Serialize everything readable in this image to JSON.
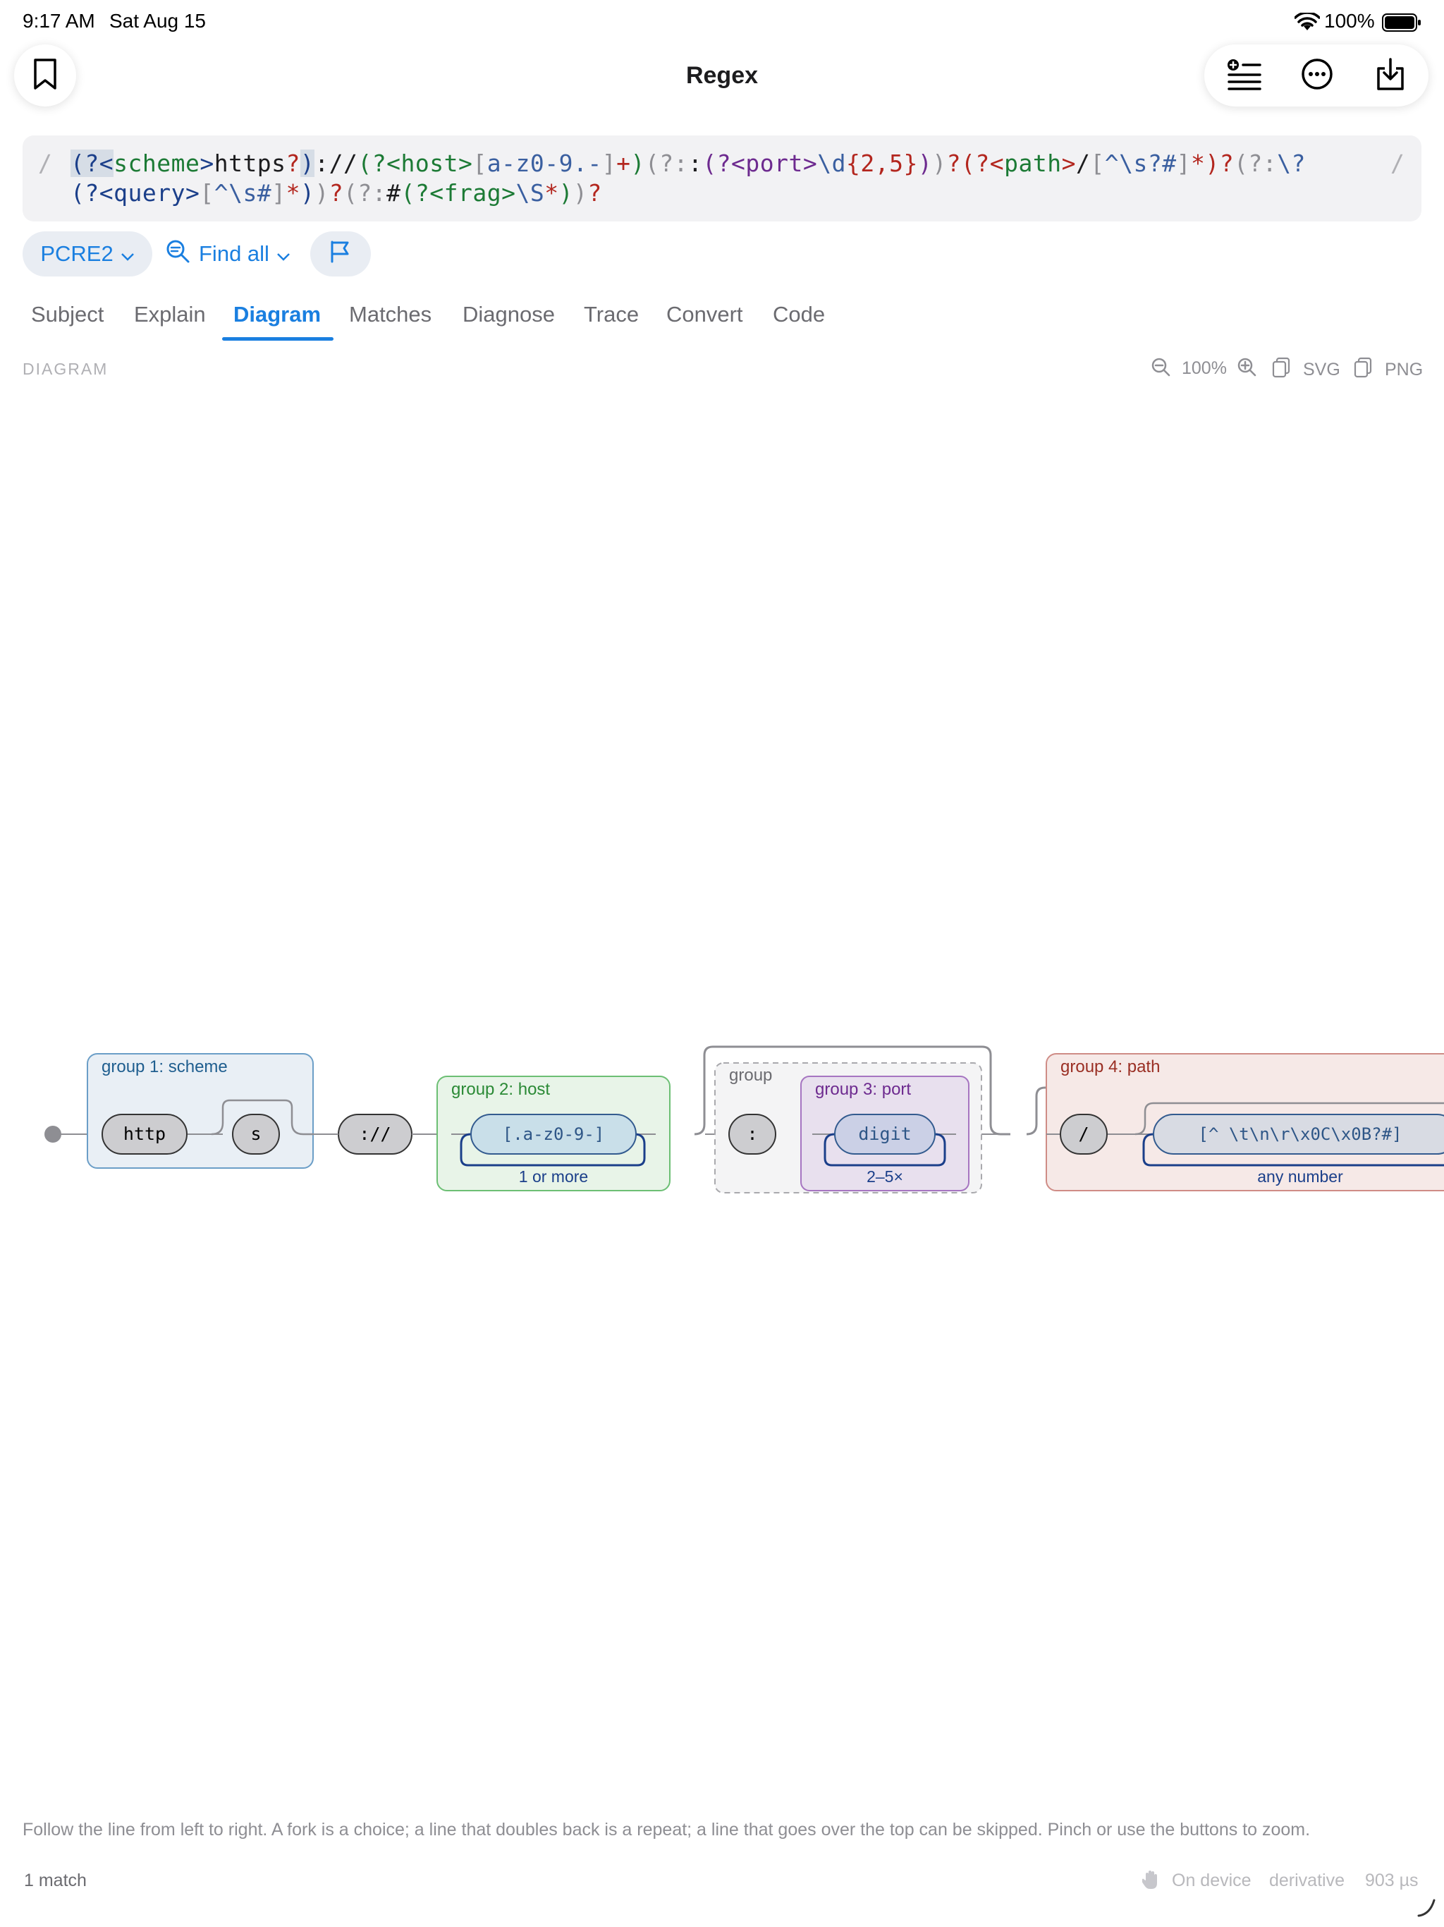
{
  "status_bar": {
    "time": "9:17 AM",
    "date": "Sat Aug 15",
    "battery": "100%"
  },
  "nav": {
    "title": "Regex"
  },
  "regex": {
    "delimiter": "/",
    "line1": [
      {
        "t": "(?<",
        "c": "t-sym"
      },
      {
        "t": "scheme",
        "c": "t-name"
      },
      {
        "t": ">",
        "c": "t-sym"
      },
      {
        "t": "https",
        "c": "t-lit"
      },
      {
        "t": "?",
        "c": "t-qty"
      },
      {
        "t": ")",
        "c": "t-sym"
      },
      {
        "t": "://",
        "c": "t-lit"
      },
      {
        "t": "(?<",
        "c": "t-name"
      },
      {
        "t": "host",
        "c": "t-name"
      },
      {
        "t": ">",
        "c": "t-name"
      },
      {
        "t": "[",
        "c": "t-dim"
      },
      {
        "t": "a-z0-9.-",
        "c": "t-cls"
      },
      {
        "t": "]",
        "c": "t-dim"
      },
      {
        "t": "+",
        "c": "t-qty"
      },
      {
        "t": ")",
        "c": "t-name"
      },
      {
        "t": "(?:",
        "c": "t-dim"
      },
      {
        "t": ":",
        "c": "t-lit"
      },
      {
        "t": "(?<",
        "c": "t-grp"
      },
      {
        "t": "port",
        "c": "t-grp"
      },
      {
        "t": ">",
        "c": "t-grp"
      },
      {
        "t": "\\d",
        "c": "t-cls"
      },
      {
        "t": "{2,5}",
        "c": "t-qty"
      },
      {
        "t": ")",
        "c": "t-grp"
      },
      {
        "t": ")",
        "c": "t-dim"
      },
      {
        "t": "?",
        "c": "t-qty"
      },
      {
        "t": "(?<",
        "c": "t-qty"
      },
      {
        "t": "path",
        "c": "t-name"
      },
      {
        "t": ">",
        "c": "t-qty"
      },
      {
        "t": "/",
        "c": "t-lit"
      },
      {
        "t": "[",
        "c": "t-dim"
      },
      {
        "t": "^\\s?#",
        "c": "t-cls"
      },
      {
        "t": "]",
        "c": "t-dim"
      },
      {
        "t": "*",
        "c": "t-qty"
      },
      {
        "t": ")",
        "c": "t-qty"
      },
      {
        "t": "?",
        "c": "t-qty"
      },
      {
        "t": "(?:",
        "c": "t-dim"
      },
      {
        "t": "\\?",
        "c": "t-cls"
      }
    ],
    "line2": [
      {
        "t": "(?<",
        "c": "t-sym"
      },
      {
        "t": "query",
        "c": "t-sym"
      },
      {
        "t": ">",
        "c": "t-sym"
      },
      {
        "t": "[",
        "c": "t-dim"
      },
      {
        "t": "^\\s#",
        "c": "t-cls"
      },
      {
        "t": "]",
        "c": "t-dim"
      },
      {
        "t": "*",
        "c": "t-qty"
      },
      {
        "t": ")",
        "c": "t-sym"
      },
      {
        "t": ")",
        "c": "t-dim"
      },
      {
        "t": "?",
        "c": "t-qty"
      },
      {
        "t": "(?:",
        "c": "t-dim"
      },
      {
        "t": "#",
        "c": "t-lit"
      },
      {
        "t": "(?<",
        "c": "t-name"
      },
      {
        "t": "frag",
        "c": "t-name"
      },
      {
        "t": ">",
        "c": "t-name"
      },
      {
        "t": "\\S",
        "c": "t-cls"
      },
      {
        "t": "*",
        "c": "t-qty"
      },
      {
        "t": ")",
        "c": "t-name"
      },
      {
        "t": ")",
        "c": "t-dim"
      },
      {
        "t": "?",
        "c": "t-qty"
      }
    ]
  },
  "options": {
    "flavor": "PCRE2",
    "mode": "Find all"
  },
  "tabs": [
    "Subject",
    "Explain",
    "Diagram",
    "Matches",
    "Diagnose",
    "Trace",
    "Convert",
    "Code"
  ],
  "active_tab": "Diagram",
  "diagram_panel": {
    "label": "DIAGRAM",
    "zoom": "100%",
    "export_svg": "SVG",
    "export_png": "PNG"
  },
  "diagram": {
    "group1_label": "group 1: scheme",
    "http": "http",
    "s": "s",
    "sep": "://",
    "group2_label": "group 2: host",
    "host_class": "[.a-z0-9-]",
    "host_repeat": "1 or more",
    "group_label": "group",
    "colon": ":",
    "group3_label": "group 3: port",
    "digit": "digit",
    "port_repeat": "2–5×",
    "group4_label": "group 4: path",
    "slash": "/",
    "path_class": "[^ \\t\\n\\r\\x0C\\x0B?#]",
    "path_repeat": "any number"
  },
  "help_text": "Follow the line from left to right. A fork is a choice; a line that doubles back is a repeat; a line that goes over the top can be skipped. Pinch or use the buttons to zoom.",
  "footer": {
    "matches": "1 match",
    "on_device": "On device",
    "derivative": "derivative",
    "timing": "903 µs"
  },
  "colors": {
    "accent": "#1a7fe0",
    "scheme_group": "#3d77a8",
    "host_group": "#2f9a3e",
    "port_group": "#7a3f99",
    "path_group": "#b45b54"
  }
}
